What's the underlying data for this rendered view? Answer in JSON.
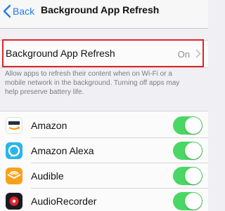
{
  "nav": {
    "back_label": "Back",
    "title": "Background App Refresh"
  },
  "refresh_setting": {
    "label": "Background App Refresh",
    "value": "On"
  },
  "footer_note": {
    "lines": [
      "Allow apps to refresh their content when on Wi-Fi or a",
      "mobile network in the background. Turning off apps may",
      "help preserve battery life."
    ]
  },
  "apps": [
    {
      "name": "Amazon",
      "icon": "amazon-icon",
      "enabled": true
    },
    {
      "name": "Amazon Alexa",
      "icon": "amazon-alexa-icon",
      "enabled": true
    },
    {
      "name": "Audible",
      "icon": "audible-icon",
      "enabled": true
    },
    {
      "name": "AudioRecorder",
      "icon": "audio-recorder-icon",
      "enabled": true
    }
  ],
  "colors": {
    "accent": "#1e7cf5",
    "toggle_on": "#4bd763",
    "highlight": "#e0242c"
  }
}
